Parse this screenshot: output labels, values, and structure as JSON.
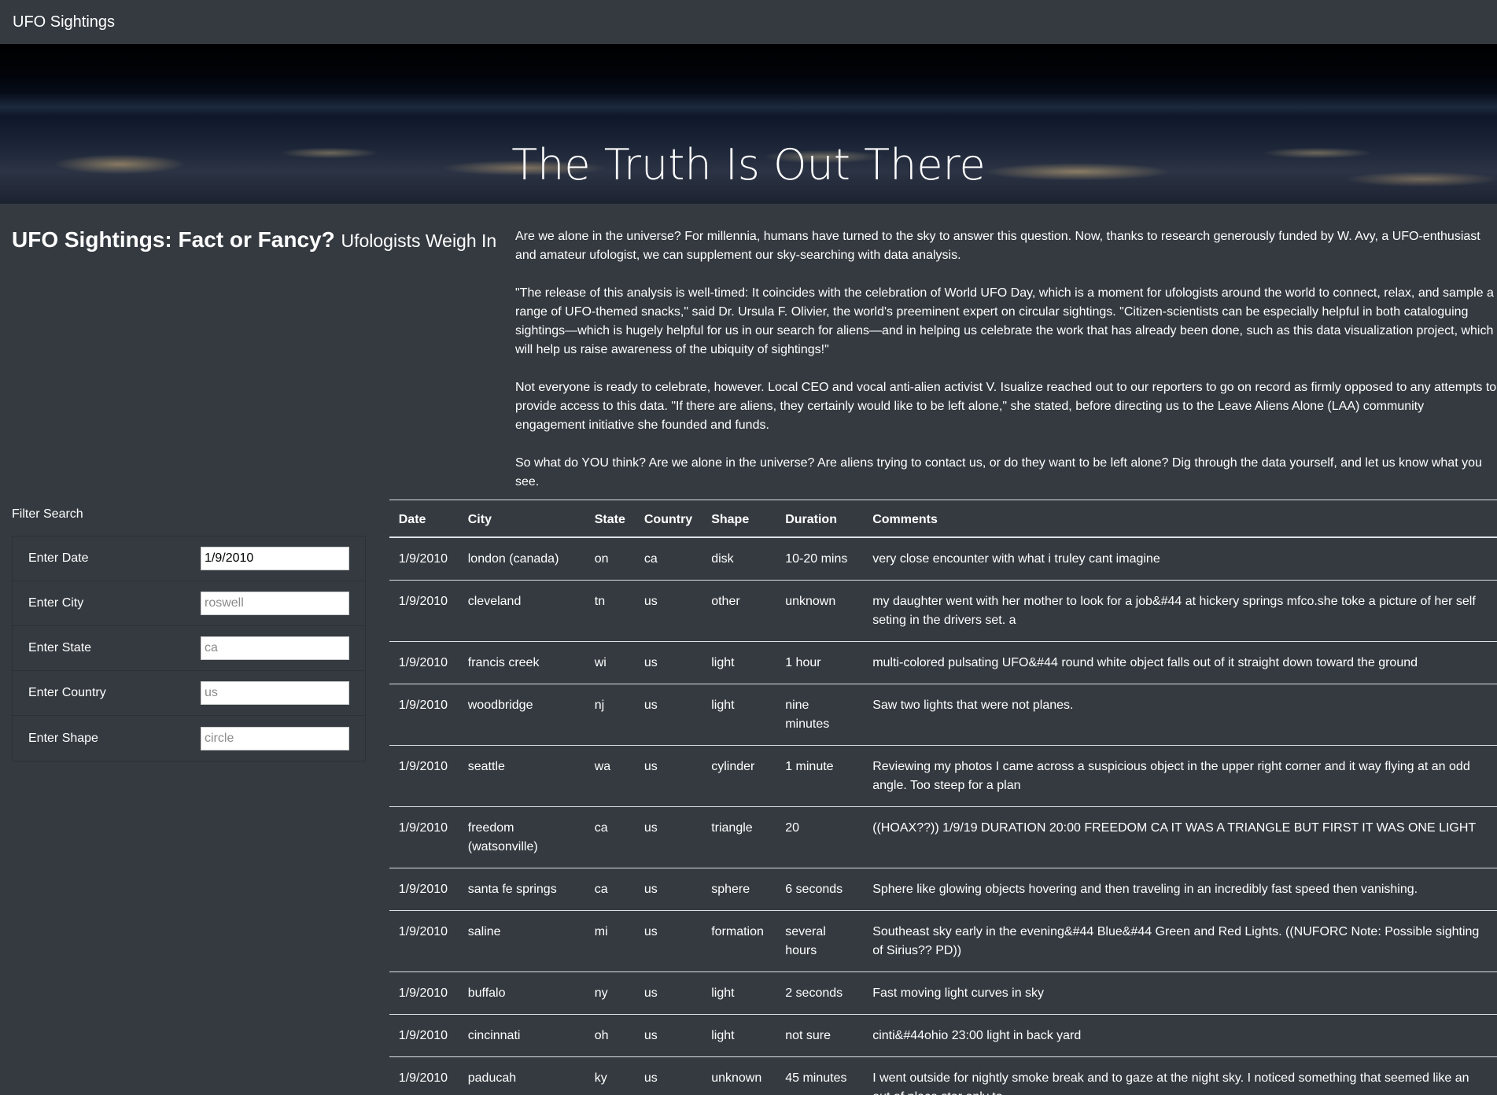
{
  "navbar": {
    "brand": "UFO Sightings"
  },
  "hero": {
    "title": "The Truth Is Out There"
  },
  "intro": {
    "heading": "UFO Sightings: Fact or Fancy?",
    "subheading": "Ufologists Weigh In",
    "paragraphs": [
      "Are we alone in the universe? For millennia, humans have turned to the sky to answer this question. Now, thanks to research generously funded by W. Avy, a UFO-enthusiast and amateur ufologist, we can supplement our sky-searching with data analysis.",
      "\"The release of this analysis is well-timed: It coincides with the celebration of World UFO Day, which is a moment for ufologists around the world to connect, relax, and sample a range of UFO-themed snacks,\" said Dr. Ursula F. Olivier, the world's preeminent expert on circular sightings. \"Citizen-scientists can be especially helpful in both cataloguing sightings—which is hugely helpful for us in our search for aliens—and in helping us celebrate the work that has already been done, such as this data visualization project, which will help us raise awareness of the ubiquity of sightings!\"",
      "Not everyone is ready to celebrate, however. Local CEO and vocal anti-alien activist V. Isualize reached out to our reporters to go on record as firmly opposed to any attempts to provide access to this data. \"If there are aliens, they certainly would like to be left alone,\" she stated, before directing us to the Leave Aliens Alone (LAA) community engagement initiative she founded and funds.",
      "So what do YOU think? Are we alone in the universe? Are aliens trying to contact us, or do they want to be left alone? Dig through the data yourself, and let us know what you see."
    ]
  },
  "filters": {
    "title": "Filter Search",
    "fields": [
      {
        "label": "Enter Date",
        "value": "1/9/2010",
        "placeholder": ""
      },
      {
        "label": "Enter City",
        "value": "",
        "placeholder": "roswell"
      },
      {
        "label": "Enter State",
        "value": "",
        "placeholder": "ca"
      },
      {
        "label": "Enter Country",
        "value": "",
        "placeholder": "us"
      },
      {
        "label": "Enter Shape",
        "value": "",
        "placeholder": "circle"
      }
    ]
  },
  "table": {
    "headers": [
      "Date",
      "City",
      "State",
      "Country",
      "Shape",
      "Duration",
      "Comments"
    ],
    "rows": [
      [
        "1/9/2010",
        "london (canada)",
        "on",
        "ca",
        "disk",
        "10-20 mins",
        "very close encounter with what i truley cant imagine"
      ],
      [
        "1/9/2010",
        "cleveland",
        "tn",
        "us",
        "other",
        "unknown",
        "my daughter went with her mother to look for a job&#44 at hickery springs mfco.she toke a picture of her self seting in the drivers set. a"
      ],
      [
        "1/9/2010",
        "francis creek",
        "wi",
        "us",
        "light",
        "1 hour",
        "multi-colored pulsating UFO&#44 round white object falls out of it straight down toward the ground"
      ],
      [
        "1/9/2010",
        "woodbridge",
        "nj",
        "us",
        "light",
        "nine minutes",
        "Saw two lights that were not planes."
      ],
      [
        "1/9/2010",
        "seattle",
        "wa",
        "us",
        "cylinder",
        "1 minute",
        "Reviewing my photos I came across a suspicious object in the upper right corner and it way flying at an odd angle. Too steep for a plan"
      ],
      [
        "1/9/2010",
        "freedom (watsonville)",
        "ca",
        "us",
        "triangle",
        "20",
        "((HOAX??)) 1/9/19 DURATION 20:00 FREEDOM CA IT WAS A TRIANGLE BUT FIRST IT WAS ONE LIGHT"
      ],
      [
        "1/9/2010",
        "santa fe springs",
        "ca",
        "us",
        "sphere",
        "6 seconds",
        "Sphere like glowing objects hovering and then traveling in an incredibly fast speed then vanishing."
      ],
      [
        "1/9/2010",
        "saline",
        "mi",
        "us",
        "formation",
        "several hours",
        "Southeast sky early in the evening&#44 Blue&#44 Green and Red Lights. ((NUFORC Note: Possible sighting of Sirius?? PD))"
      ],
      [
        "1/9/2010",
        "buffalo",
        "ny",
        "us",
        "light",
        "2 seconds",
        "Fast moving light curves in sky"
      ],
      [
        "1/9/2010",
        "cincinnati",
        "oh",
        "us",
        "light",
        "not sure",
        "cinti&#44ohio 23:00 light in back yard"
      ],
      [
        "1/9/2010",
        "paducah",
        "ky",
        "us",
        "unknown",
        "45 minutes",
        "I went outside for nightly smoke break and to gaze at the night sky. I noticed something that seemed like an out of place star only to"
      ]
    ]
  }
}
